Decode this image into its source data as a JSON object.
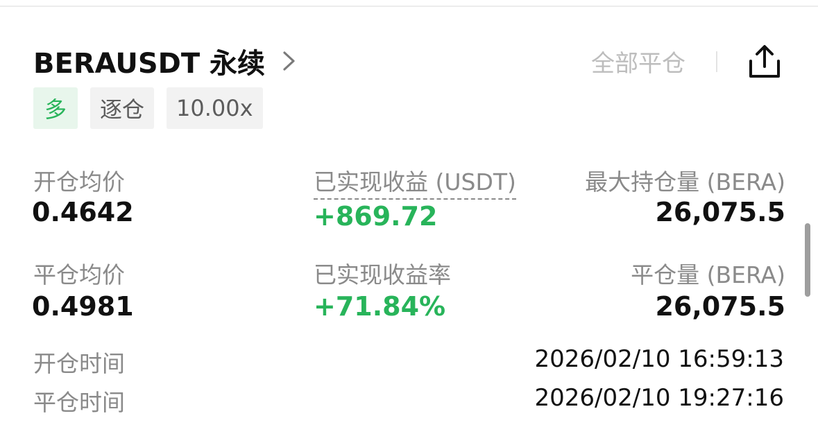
{
  "header": {
    "pair_title": "BERAUSDT 永续",
    "close_all_label": "全部平仓"
  },
  "tags": {
    "side": "多",
    "margin_mode": "逐仓",
    "leverage": "10.00x"
  },
  "stats": {
    "open_avg_price_label": "开仓均价",
    "open_avg_price": "0.4642",
    "realized_pnl_label": "已实现收益 (USDT)",
    "realized_pnl": "+869.72",
    "max_position_label": "最大持仓量 (BERA)",
    "max_position": "26,075.5",
    "close_avg_price_label": "平仓均价",
    "close_avg_price": "0.4981",
    "realized_pnl_rate_label": "已实现收益率",
    "realized_pnl_rate": "+71.84%",
    "closed_amount_label": "平仓量 (BERA)",
    "closed_amount": "26,075.5"
  },
  "times": {
    "open_time_label": "开仓时间",
    "open_time": "2026/02/10 16:59:13",
    "close_time_label": "平仓时间",
    "close_time": "2026/02/10 19:27:16"
  },
  "colors": {
    "profit_green": "#28b45a",
    "long_tag_bg": "#e8f6ec",
    "muted_label": "#8a8a8a"
  },
  "icons": {
    "detail": "chevron-right-icon",
    "share": "share-icon"
  }
}
